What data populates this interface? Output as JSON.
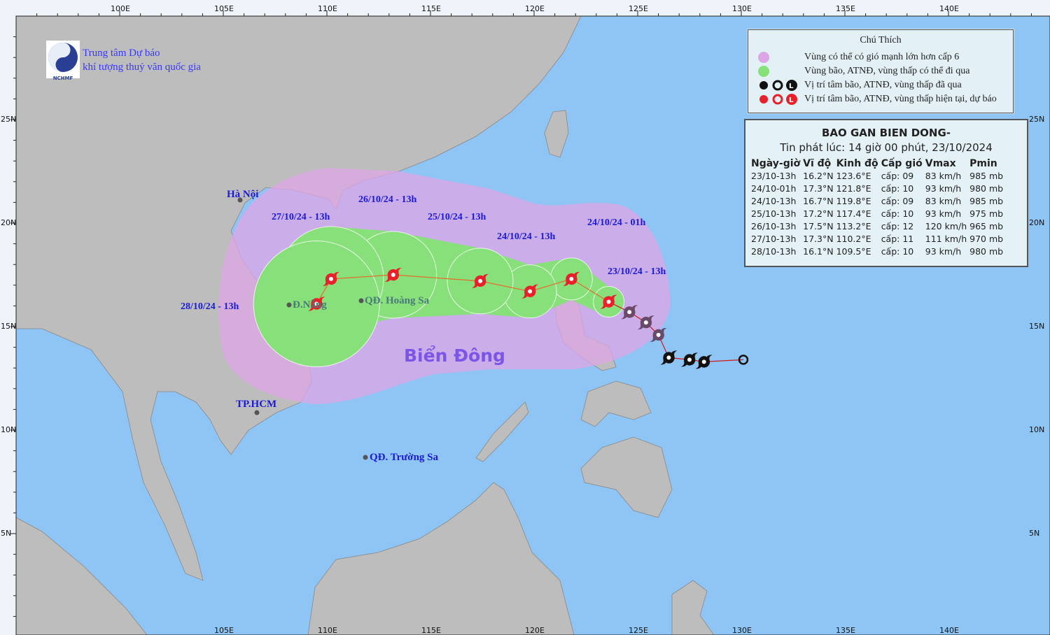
{
  "logo": {
    "line1": "Trung tâm Dự báo",
    "line2": "khí tượng thuỷ văn quốc gia",
    "abbr": "NCHMF"
  },
  "axes": {
    "top": [
      "100E",
      "105E",
      "110E",
      "115E",
      "120E",
      "125E",
      "130E",
      "135E",
      "140E"
    ],
    "bottom": [
      "105E",
      "110E",
      "115E",
      "120E",
      "125E",
      "130E",
      "135E",
      "140E"
    ],
    "lat": [
      "25N",
      "20N",
      "15N",
      "10N",
      "5N"
    ]
  },
  "legend": {
    "title": "Chú Thích",
    "items": [
      {
        "label": "Vùng có thể có gió mạnh lớn hơn cấp 6",
        "color": "#dca6e6"
      },
      {
        "label": "Vùng bão, ATNĐ, vùng thấp có thể đi qua",
        "color": "#88e07a"
      },
      {
        "label": "Vị trí tâm bão, ATNĐ, vùng thấp đã qua",
        "color": "#111111"
      },
      {
        "label": "Vị trí tâm bão, ATNĐ, vùng thấp hiện tại, dự báo",
        "color": "#e8202a"
      }
    ],
    "symbol_letter": "L"
  },
  "info": {
    "title": "BAO GAN BIEN DONG-",
    "issued": "Tin phát lúc: 14 giờ 00 phút, 23/10/2024",
    "headers": [
      "Ngày-giờ",
      "Vĩ độ",
      "Kinh độ",
      "Cấp gió",
      "Vmax",
      "Pmin"
    ],
    "rows": [
      [
        "23/10-13h",
        "16.2°N",
        "123.6°E",
        "cấp: 09",
        "83 km/h",
        "985 mb"
      ],
      [
        "24/10-01h",
        "17.3°N",
        "121.8°E",
        "cấp: 10",
        "93 km/h",
        "980 mb"
      ],
      [
        "24/10-13h",
        "16.7°N",
        "119.8°E",
        "cấp: 09",
        "83 km/h",
        "985 mb"
      ],
      [
        "25/10-13h",
        "17.2°N",
        "117.4°E",
        "cấp: 10",
        "93 km/h",
        "975 mb"
      ],
      [
        "26/10-13h",
        "17.5°N",
        "113.2°E",
        "cấp: 12",
        "120 km/h",
        "965 mb"
      ],
      [
        "27/10-13h",
        "17.3°N",
        "110.2°E",
        "cấp: 11",
        "111 km/h",
        "970 mb"
      ],
      [
        "28/10-13h",
        "16.1°N",
        "109.5°E",
        "cấp: 10",
        "93 km/h",
        "980 mb"
      ]
    ]
  },
  "forecast_track": [
    {
      "lat": 16.2,
      "lon": 123.6
    },
    {
      "lat": 17.3,
      "lon": 121.8
    },
    {
      "lat": 16.7,
      "lon": 119.8
    },
    {
      "lat": 17.2,
      "lon": 117.4
    },
    {
      "lat": 17.5,
      "lon": 113.2
    },
    {
      "lat": 17.3,
      "lon": 110.2
    },
    {
      "lat": 16.1,
      "lon": 109.5
    }
  ],
  "past_track": [
    {
      "lat": 15.7,
      "lon": 124.6
    },
    {
      "lat": 15.2,
      "lon": 125.4
    },
    {
      "lat": 14.6,
      "lon": 126.0
    },
    {
      "lat": 13.5,
      "lon": 126.5
    },
    {
      "lat": 13.4,
      "lon": 127.5
    },
    {
      "lat": 13.3,
      "lon": 128.2
    },
    {
      "lat": 13.4,
      "lon": 130.1,
      "type": "low"
    }
  ],
  "time_labels": [
    "23/10/24 - 13h",
    "24/10/24 - 01h",
    "24/10/24 - 13h",
    "25/10/24 - 13h",
    "26/10/24 - 13h",
    "27/10/24 - 13h",
    "28/10/24 - 13h"
  ],
  "places": {
    "hanoi": "Hà Nội",
    "danang": "Đ.Nẵng",
    "hoangsa": "QĐ. Hoàng Sa",
    "truongsa": "QĐ. Trường Sa",
    "hcm": "TP.HCM"
  },
  "sea_name": "Biển Đông",
  "colors": {
    "sea": "#8ec5f4",
    "land": "#bdbdbd",
    "wind_zone": "#dca6e6",
    "storm_zone": "#88e07a",
    "track": "#e86a2a"
  }
}
